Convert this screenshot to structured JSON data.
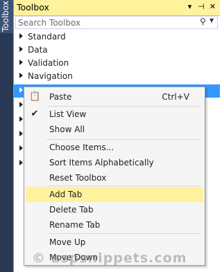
{
  "side_tab": {
    "label": "Toolbox"
  },
  "window": {
    "title": "Toolbox",
    "icons": [
      "dropdown-icon",
      "pin-icon",
      "close-icon"
    ],
    "title_icon_glyphs": {
      "dropdown": "▾",
      "pin": "⊣",
      "close": "✕"
    }
  },
  "search": {
    "placeholder": "Search Toolbox",
    "icon_glyph": "⚲",
    "dropdown_glyph": "▼"
  },
  "tree": {
    "items": [
      {
        "label": "Standard"
      },
      {
        "label": "Data"
      },
      {
        "label": "Validation"
      },
      {
        "label": "Navigation"
      },
      {
        "label": ""
      },
      {
        "label": ""
      },
      {
        "label": ""
      },
      {
        "label": ""
      },
      {
        "label": ""
      },
      {
        "label": ""
      }
    ]
  },
  "context_menu": {
    "items": [
      {
        "label": "Paste",
        "shortcut": "Ctrl+V",
        "icon": "paste-icon",
        "icon_glyph": "📋"
      },
      {
        "label": "List View",
        "icon": "checkmark-icon",
        "icon_glyph": "✔"
      },
      {
        "label": "Show All"
      },
      {
        "label": "Choose Items..."
      },
      {
        "label": "Sort Items Alphabetically"
      },
      {
        "label": "Reset Toolbox"
      },
      {
        "label": "Add Tab"
      },
      {
        "label": "Delete Tab"
      },
      {
        "label": "Rename Tab"
      },
      {
        "label": "Move Up"
      },
      {
        "label": "Move Down"
      }
    ]
  },
  "watermark": "© aspsnippets.com",
  "colors": {
    "title_bar": "#fff29d",
    "highlight": "#fff29d",
    "side_strip": "#293955",
    "selection": "#3399ff"
  }
}
